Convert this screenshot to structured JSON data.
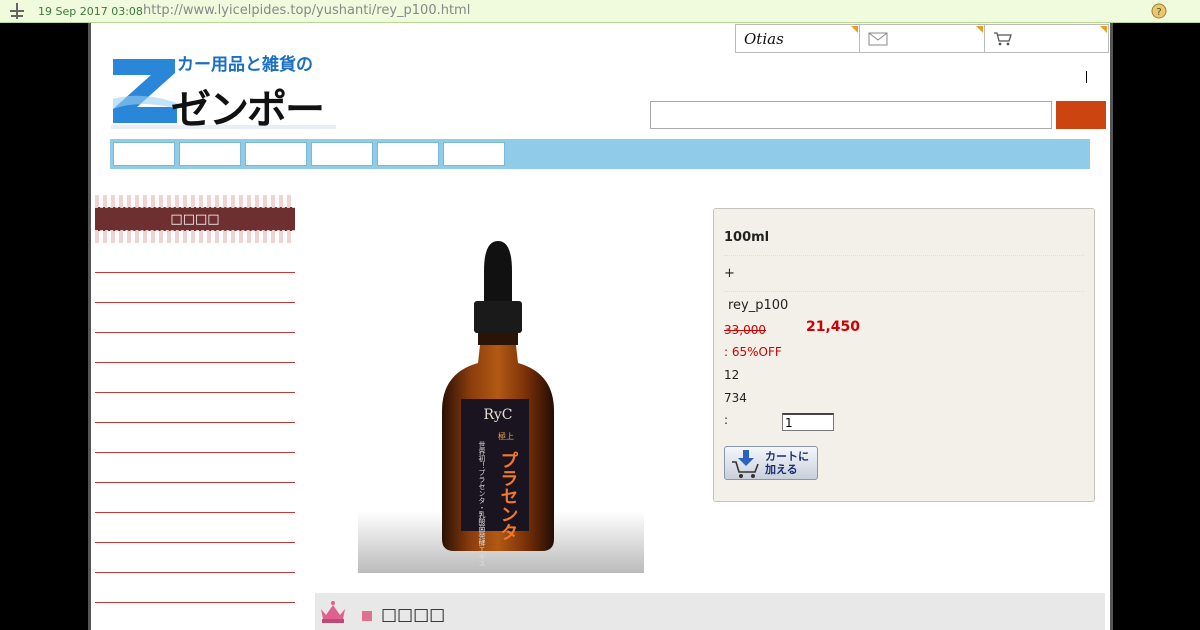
{
  "wayback": {
    "date": "19 Sep 2017 03:08",
    "url": "http://www.lyicelpides.top/yushanti/rey_p100.html"
  },
  "header": {
    "logo_tagline": "カー用品と雑貨の",
    "logo_name": "ゼンポー",
    "top_links": [
      {
        "label": "Otias",
        "icon": "brand-logo"
      },
      {
        "label": "",
        "icon": "mail-icon"
      },
      {
        "label": "",
        "icon": "cart-icon"
      }
    ],
    "search": {
      "placeholder": "",
      "button_label": ""
    }
  },
  "nav": {
    "items": [
      "",
      "",
      "",
      "",
      "",
      ""
    ]
  },
  "sidebar": {
    "heading": "□□□□",
    "items": [
      "",
      "",
      "",
      "",
      "",
      "",
      "",
      "",
      "",
      "",
      "",
      ""
    ]
  },
  "product": {
    "image_alt": "Amber dropper bottle",
    "bottle_labels": {
      "brand": "RyC",
      "name": "プラセンタ",
      "grade": "極上",
      "sub": "世界初！プラセンタ・乳酸菌発酵エキス"
    },
    "name": "100ml",
    "plus": "+",
    "code": "rey_p100",
    "old_price": "33,000",
    "new_price": "21,450",
    "discount": ": 65%OFF",
    "value1": "12",
    "value2": "734",
    "qty_label": ":",
    "qty_value": "1",
    "cart_button": "カートに\n加える"
  },
  "section": {
    "title": "□□□□"
  },
  "colors": {
    "accent": "#cc4410",
    "nav_bg": "#90cce8",
    "sidebar_band": "#6e2f30",
    "price_red": "#cc0000"
  }
}
